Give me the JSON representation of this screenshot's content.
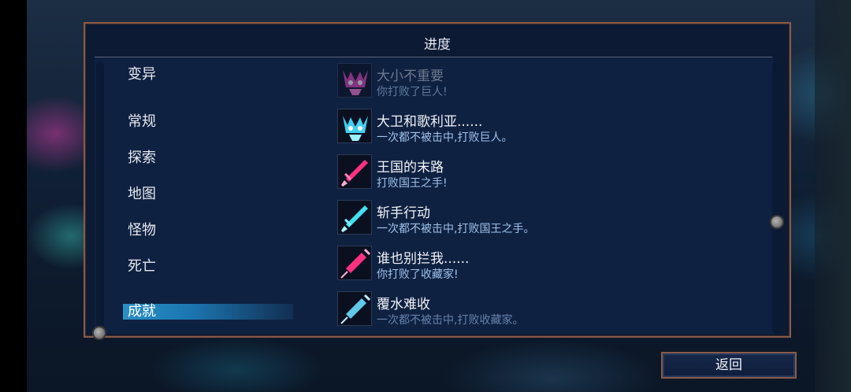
{
  "panel": {
    "title": "进度"
  },
  "categories": [
    {
      "label": "变异",
      "selected": false
    },
    {
      "label": "常规",
      "selected": false
    },
    {
      "label": "探索",
      "selected": false
    },
    {
      "label": "地图",
      "selected": false
    },
    {
      "label": "怪物",
      "selected": false
    },
    {
      "label": "死亡",
      "selected": false
    },
    {
      "label": "成就",
      "selected": true
    }
  ],
  "achievements": [
    {
      "title": "大小不重要",
      "description": "你打败了巨人!",
      "icon": "giant-skull-icon",
      "color": "#e040b0"
    },
    {
      "title": "大卫和歌利亚......",
      "description": "一次都不被击中,打败巨人。",
      "icon": "giant-skull-icon",
      "color": "#40d0f0"
    },
    {
      "title": "王国的末路",
      "description": "打败国王之手!",
      "icon": "sword-icon",
      "color": "#ff3080"
    },
    {
      "title": "斩手行动",
      "description": "一次都不被击中,打败国王之手。",
      "icon": "sword-icon",
      "color": "#40e0f0"
    },
    {
      "title": "谁也别拦我......",
      "description": "你打败了收藏家!",
      "icon": "syringe-icon",
      "color": "#ff3080"
    },
    {
      "title": "覆水难收",
      "description": "一次都不被击中,打败收藏家。",
      "icon": "syringe-icon",
      "color": "#60c8e8"
    }
  ],
  "footer": {
    "return_label": "返回"
  }
}
